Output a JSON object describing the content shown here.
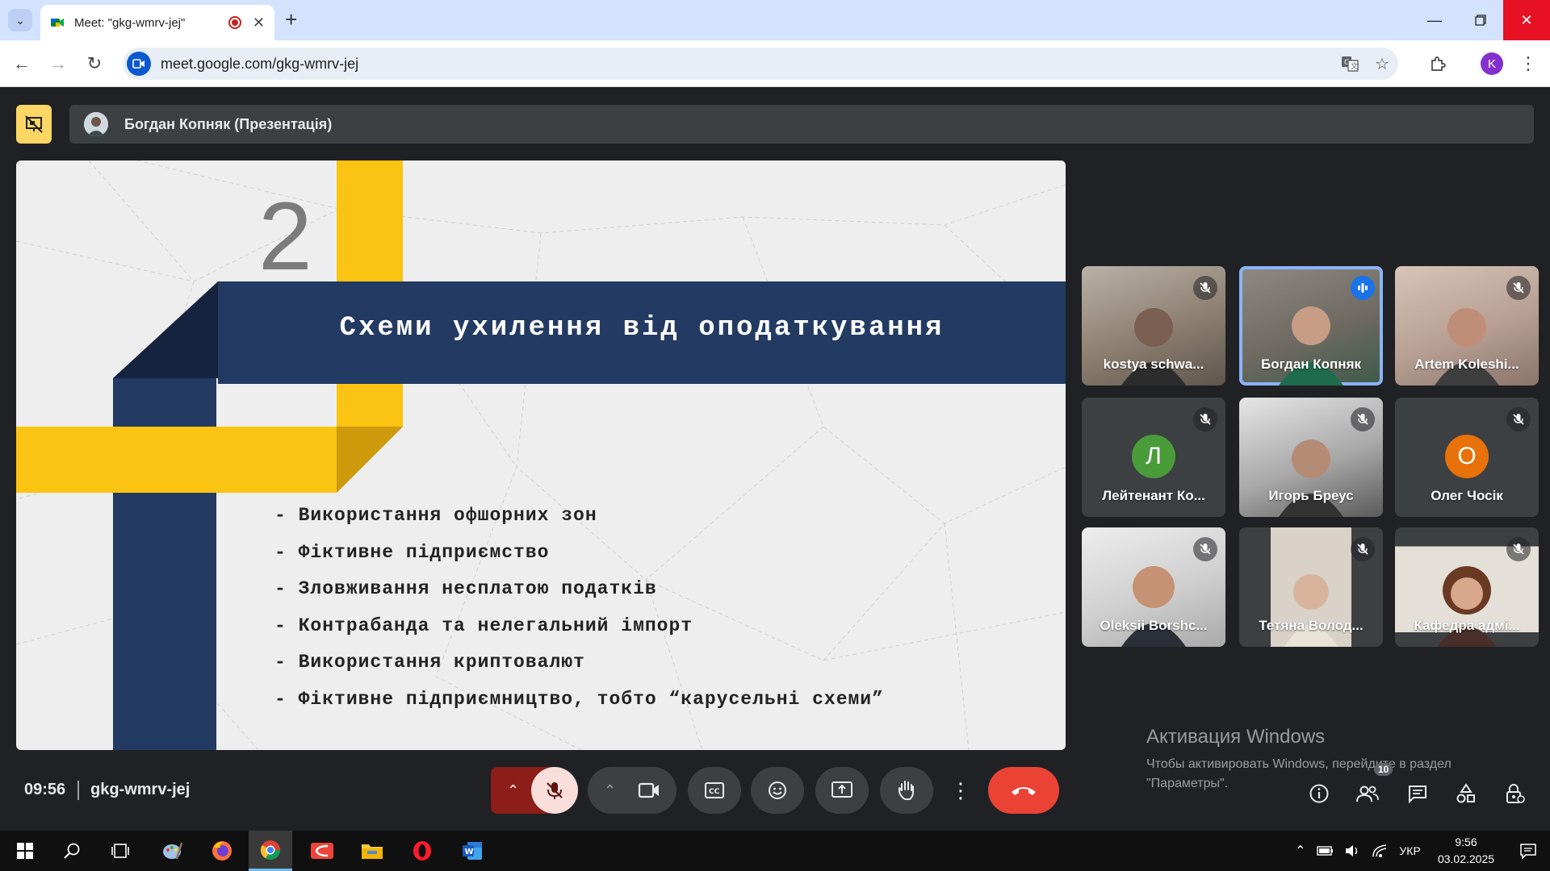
{
  "browser": {
    "tab_title": "Meet: \"gkg-wmrv-jej\"",
    "url": "meet.google.com/gkg-wmrv-jej",
    "profile_initial": "K"
  },
  "presenter": {
    "label": "Богдан Копняк (Презентація)"
  },
  "slide": {
    "number": "2",
    "title": "Схеми ухилення від оподаткування",
    "bullets": [
      "- Використання офшорних зон",
      "- Фіктивне підприємство",
      "- Зловживання несплатою податків",
      "- Контрабанда та нелегальний імпорт",
      "- Використання криптовалют",
      "- Фіктивне підприємництво, тобто “карусельні схеми”"
    ]
  },
  "participants": [
    {
      "name": "kostya schwa...",
      "muted": true
    },
    {
      "name": "Богдан Копняк",
      "muted": false,
      "speaking": true
    },
    {
      "name": "Artem Koleshi...",
      "muted": true
    },
    {
      "name": "Лейтенант Ко...",
      "muted": true,
      "initial": "Л",
      "color": "#4a9b3a"
    },
    {
      "name": "Игорь Бреус",
      "muted": true
    },
    {
      "name": "Олег Чосік",
      "muted": true,
      "initial": "О",
      "color": "#e8710a"
    },
    {
      "name": "Oleksii Borshc...",
      "muted": true
    },
    {
      "name": "Тетяна Волод...",
      "muted": true
    },
    {
      "name": "Кафедра адмі...",
      "muted": true
    }
  ],
  "watermark": {
    "title": "Активация Windows",
    "subtitle": "Чтобы активировать Windows, перейдите в раздел \"Параметры\"."
  },
  "bottom_bar": {
    "time": "09:56",
    "meeting_code": "gkg-wmrv-jej",
    "people_count": "10"
  },
  "taskbar": {
    "language": "УКР",
    "time": "9:56",
    "date": "03.02.2025"
  },
  "colors": {
    "slide_navy": "#233a63",
    "slide_yellow": "#fbc312",
    "meet_bg": "#202124",
    "hangup_red": "#ea4335"
  }
}
